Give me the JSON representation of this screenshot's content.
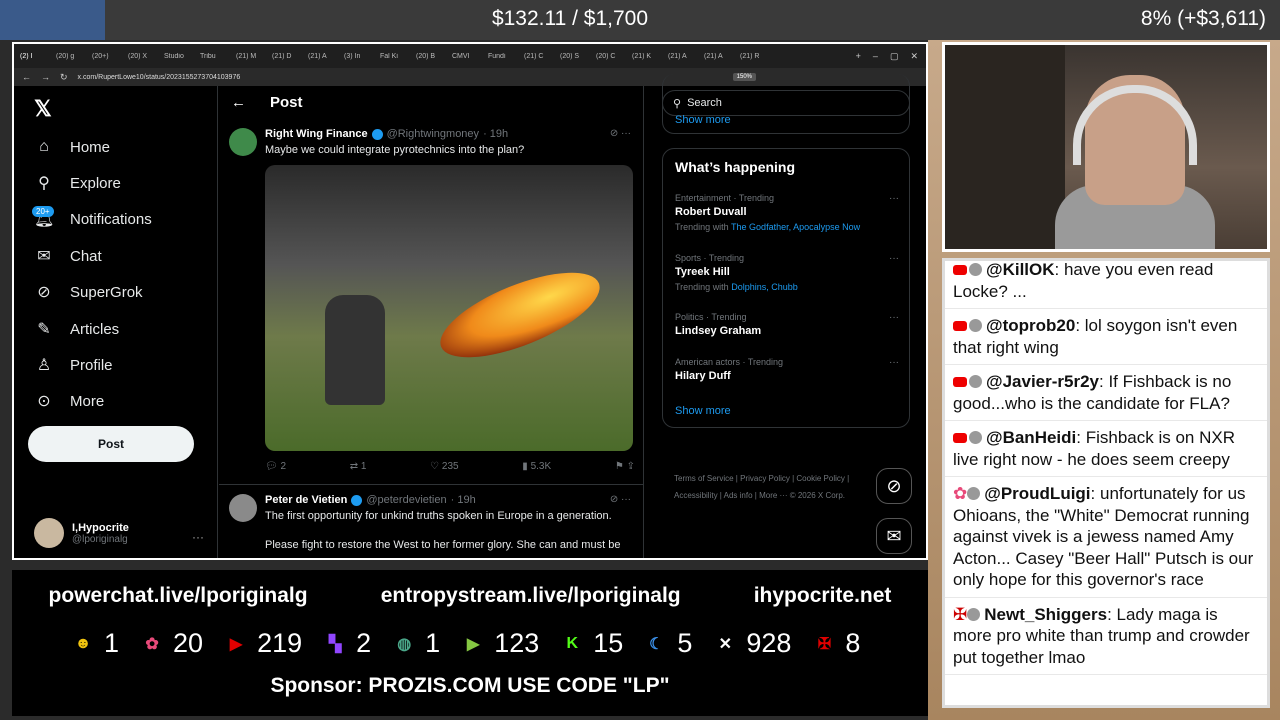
{
  "topbar": {
    "goal": "$132.11 / $1,700",
    "percent": "8% (+$3,611)"
  },
  "browser": {
    "tabs": [
      "(2) I",
      "(20) g",
      "(20+)",
      "(20) X",
      "Studio",
      "Tribu",
      "(21) M",
      "(21) D",
      "(21) A",
      "(3) In",
      "Fal Ki",
      "(20) B",
      "CMVI",
      "Fundi",
      "(21) C",
      "(20) S",
      "(20) C",
      "(21) K",
      "(21) A",
      "(21) A",
      "(21) R"
    ],
    "url": "x.com/RupertLowe10/status/2023155273704103976",
    "zoom": "150%"
  },
  "nav": {
    "items": [
      "Home",
      "Explore",
      "Notifications",
      "Chat",
      "SuperGrok",
      "Articles",
      "Profile",
      "More"
    ],
    "notif_badge": "20+",
    "post_button": "Post",
    "me_name": "I,Hypocrite",
    "me_handle": "@lporiginalg"
  },
  "center": {
    "title": "Post",
    "tweet1": {
      "name": "Right Wing Finance",
      "handle": "@Rightwingmoney",
      "time": "· 19h",
      "text": "Maybe we could integrate pyrotechnics into the plan?",
      "replies": "2",
      "reposts": "1",
      "likes": "235",
      "views": "5.3K"
    },
    "tweet2": {
      "name": "Peter de Vietien",
      "handle": "@peterdevietien",
      "time": "· 19h",
      "text1": "The first opportunity for unkind truths spoken in Europe in a generation.",
      "text2": "Please fight to restore the West to her former glory. She can and must be"
    }
  },
  "right": {
    "search_placeholder": "Search",
    "show_more": "Show more",
    "whats_happening": "What’s happening",
    "trends": [
      {
        "category": "Entertainment · Trending",
        "name": "Robert Duvall",
        "with_label": "Trending with",
        "with": "The Godfather, Apocalypse Now"
      },
      {
        "category": "Sports · Trending",
        "name": "Tyreek Hill",
        "with_label": "Trending with",
        "with": "Dolphins, Chubb"
      },
      {
        "category": "Politics · Trending",
        "name": "Lindsey Graham",
        "with_label": "",
        "with": ""
      },
      {
        "category": "American actors · Trending",
        "name": "Hilary Duff",
        "with_label": "",
        "with": ""
      }
    ],
    "footer1": "Terms of Service  |  Privacy Policy  |  Cookie Policy  |",
    "footer2": "Accessibility  |  Ads info  |  More ···  © 2026 X Corp."
  },
  "banner": {
    "link1": "powerchat.live/lporiginalg",
    "link2": "entropystream.live/lporiginalg",
    "link3": "ihypocrite.net",
    "counts": [
      {
        "icon": "rumble-face-icon",
        "color": "#f1c40f",
        "value": "1"
      },
      {
        "icon": "pinwheel-icon",
        "color": "#e84a7a",
        "value": "20"
      },
      {
        "icon": "youtube-icon",
        "color": "#e00000",
        "value": "219"
      },
      {
        "icon": "twitch-icon",
        "color": "#9146ff",
        "value": "2"
      },
      {
        "icon": "globe-icon",
        "color": "#4aa88a",
        "value": "1"
      },
      {
        "icon": "rumble-play-icon",
        "color": "#85c742",
        "value": "123"
      },
      {
        "icon": "kick-icon",
        "color": "#53fc18",
        "value": "15"
      },
      {
        "icon": "moon-icon",
        "color": "#3a8ee6",
        "value": "5"
      },
      {
        "icon": "x-icon",
        "color": "#ffffff",
        "value": "928"
      },
      {
        "icon": "cross-icon",
        "color": "#e00000",
        "value": "8"
      }
    ],
    "sponsor": "Sponsor: PROZIS.COM USE CODE \"LP\""
  },
  "chat": [
    {
      "user": "@KillOK",
      "text": ": have you even read Locke? ...",
      "platform": "youtube"
    },
    {
      "user": "@toprob20",
      "text": ": lol soygon isn't even that right wing",
      "platform": "youtube"
    },
    {
      "user": "@Javier-r5r2y",
      "text": ": If Fishback is no good...who is the candidate for FLA?",
      "platform": "youtube"
    },
    {
      "user": "@BanHeidi",
      "text": ": Fishback is on NXR live right now - he does seem creepy",
      "platform": "youtube"
    },
    {
      "user": "@ProudLuigi",
      "text": ": unfortunately for us Ohioans, the \"White\" Democrat running against vivek is a jewess named Amy Acton... Casey \"Beer Hall\" Putsch is our only hope for this governor's race",
      "platform": "pinwheel"
    },
    {
      "user": "Newt_Shiggers",
      "text": ": Lady maga is more pro white than trump and crowder put together lmao",
      "platform": "cross"
    }
  ]
}
